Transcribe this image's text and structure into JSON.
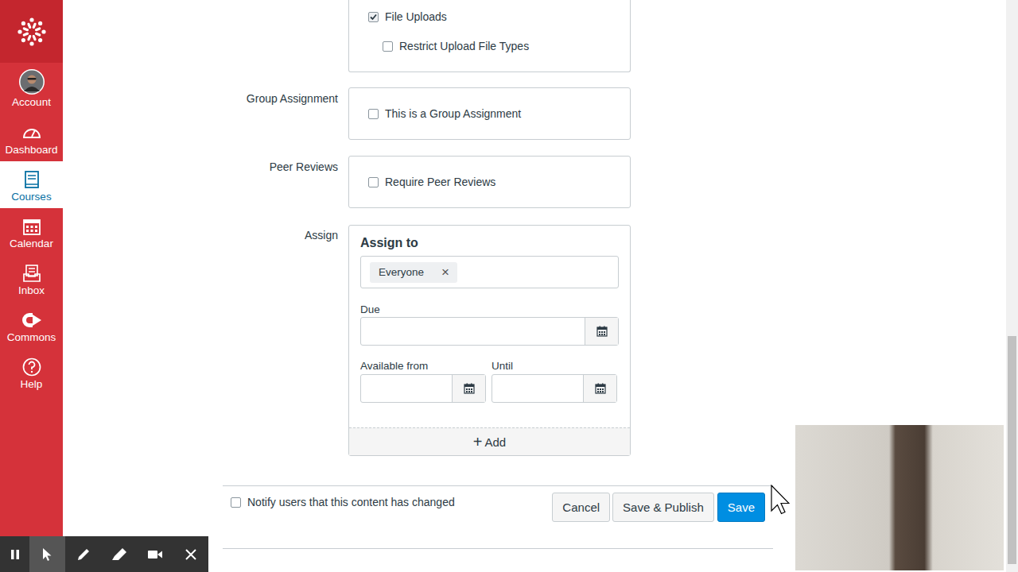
{
  "nav": {
    "items": [
      {
        "label": "Account",
        "kind": "avatar",
        "selected": false
      },
      {
        "label": "Dashboard",
        "kind": "dashboard",
        "selected": false
      },
      {
        "label": "Courses",
        "kind": "courses",
        "selected": true
      },
      {
        "label": "Calendar",
        "kind": "calendar",
        "selected": false
      },
      {
        "label": "Inbox",
        "kind": "inbox",
        "selected": false
      },
      {
        "label": "Commons",
        "kind": "commons",
        "selected": false
      },
      {
        "label": "Help",
        "kind": "help",
        "selected": false
      }
    ]
  },
  "submission_types": {
    "options": [
      {
        "label": "File Uploads",
        "checked": true,
        "kind": "option"
      },
      {
        "label": "Restrict Upload File Types",
        "checked": false,
        "kind": "sub-option"
      }
    ]
  },
  "group_assignment": {
    "label": "Group Assignment",
    "option": {
      "label": "This is a Group Assignment",
      "checked": false
    }
  },
  "peer_reviews": {
    "label": "Peer Reviews",
    "option": {
      "label": "Require Peer Reviews",
      "checked": false
    }
  },
  "assign": {
    "label": "Assign",
    "heading": "Assign to",
    "assignees": [
      {
        "label": "Everyone",
        "remove": "×"
      }
    ],
    "due": {
      "label": "Due"
    },
    "available_from": {
      "label": "Available from"
    },
    "until": {
      "label": "Until"
    },
    "add": {
      "icon": "+",
      "label": "Add"
    }
  },
  "notify": {
    "label": "Notify users that this content has changed",
    "checked": false
  },
  "buttons": [
    {
      "label": "Cancel",
      "kind": "default"
    },
    {
      "label": "Save & Publish",
      "kind": "default"
    },
    {
      "label": "Save",
      "kind": "primary"
    }
  ],
  "recorder": {
    "tools": [
      {
        "kind": "pause",
        "selected": false
      },
      {
        "kind": "pointer",
        "selected": true
      },
      {
        "kind": "pen",
        "selected": false
      },
      {
        "kind": "highlighter",
        "selected": false
      },
      {
        "kind": "camera",
        "selected": false
      },
      {
        "kind": "close",
        "selected": false
      }
    ]
  }
}
